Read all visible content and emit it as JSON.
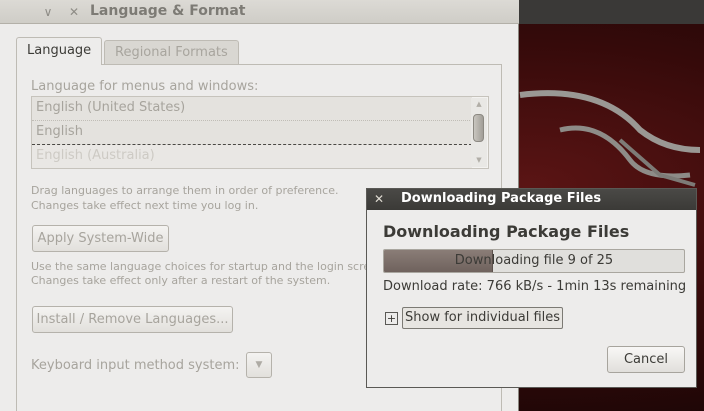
{
  "main_window": {
    "title": "Language & Format",
    "buttons": {
      "minimize": "∨",
      "close": "✕"
    },
    "tabs": [
      {
        "label": "Language",
        "active": true
      },
      {
        "label": "Regional Formats",
        "active": false
      }
    ],
    "language_section_label": "Language for menus and windows:",
    "languages": [
      "English (United States)",
      "English",
      "English (Australia)"
    ],
    "hint_drag_line1": "Drag languages to arrange them in order of preference.",
    "hint_drag_line2": "Changes take effect next time you log in.",
    "apply_button": "Apply System-Wide",
    "hint_apply_line1": "Use the same language choices for startup and the login screen.",
    "hint_apply_line2": "Changes take effect only after a restart of the system.",
    "install_button": "Install / Remove Languages...",
    "keyboard_label": "Keyboard input method system:",
    "keyboard_combo_arrow": "▼"
  },
  "download_dialog": {
    "title": "Downloading Package Files",
    "heading": "Downloading Package Files",
    "progress_text": "Downloading file 9 of 25",
    "progress_fraction": 0.36,
    "rate_text": "Download rate: 766 kB/s - 1min 13s remaining",
    "expander_glyph": "+",
    "show_files_label": "Show for individual files",
    "cancel_label": "Cancel",
    "close_glyph": "✕"
  },
  "icons": [
    "minimize-icon",
    "close-icon",
    "scroll-up-icon",
    "scroll-down-icon",
    "expander-plus-icon",
    "combo-arrow-icon"
  ],
  "colors": {
    "window_bg": "#edeceb",
    "title_dark": "#3b3a37",
    "progress_fill": "#7a6d67",
    "wallpaper_red": "#5a1414"
  }
}
